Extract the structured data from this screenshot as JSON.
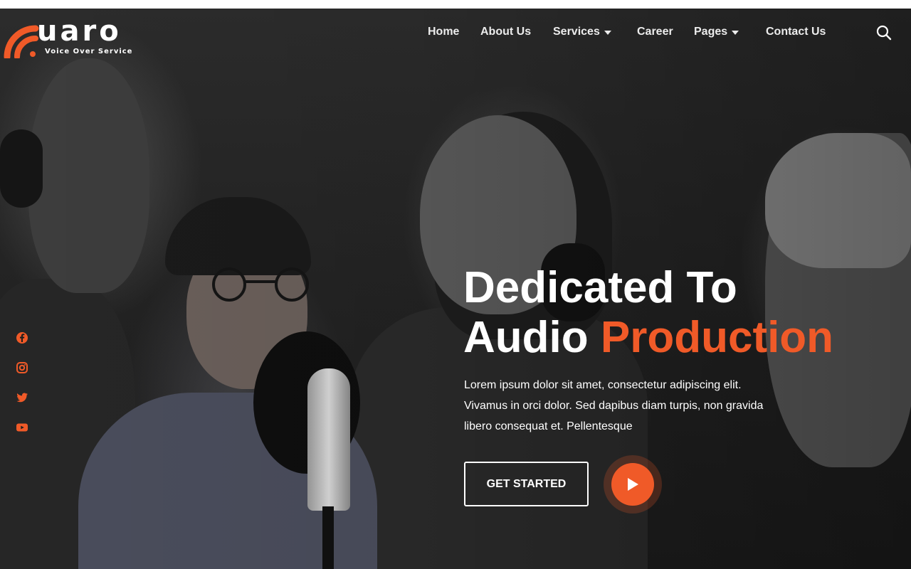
{
  "brand": {
    "name": "uaro",
    "tagline": "Voice Over Service",
    "accent_color": "#f05a28"
  },
  "nav": {
    "items": [
      {
        "label": "Home",
        "has_dropdown": false
      },
      {
        "label": "About Us",
        "has_dropdown": false
      },
      {
        "label": "Services",
        "has_dropdown": true
      },
      {
        "label": "Career",
        "has_dropdown": false
      },
      {
        "label": "Pages",
        "has_dropdown": true
      },
      {
        "label": "Contact Us",
        "has_dropdown": false
      }
    ],
    "search_icon": "search-icon"
  },
  "social": {
    "icons": [
      "facebook-icon",
      "instagram-icon",
      "twitter-icon",
      "youtube-icon"
    ]
  },
  "hero": {
    "headline_line1": "Dedicated To",
    "headline_line2_plain": "Audio",
    "headline_line2_accent": "Production",
    "description": "Lorem ipsum dolor sit amet, consectetur adipiscing elit. Vivamus in orci dolor. Sed dapibus diam turpis, non gravida libero consequat et. Pellentesque",
    "cta_label": "GET STARTED",
    "play_icon": "play-icon"
  }
}
